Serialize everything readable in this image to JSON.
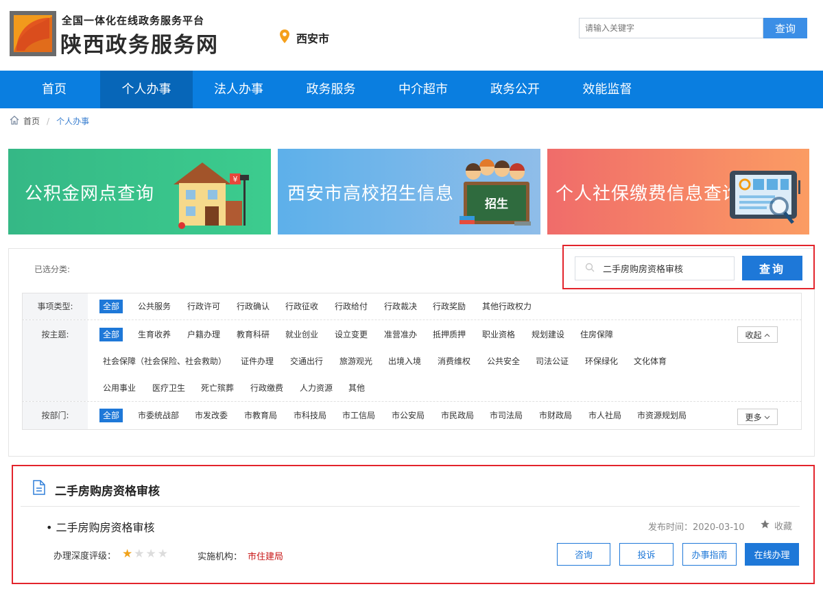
{
  "header": {
    "subtitle": "全国一体化在线政务服务平台",
    "title": "陕西政务服务网",
    "location": "西安市",
    "search_placeholder": "请输入关键字",
    "search_button": "查询"
  },
  "nav": {
    "items": [
      "首页",
      "个人办事",
      "法人办事",
      "政务服务",
      "中介超市",
      "政务公开",
      "效能监督"
    ],
    "active": "个人办事"
  },
  "breadcrumb": {
    "home": "首页",
    "current": "个人办事"
  },
  "banners": [
    {
      "text": "公积金网点查询",
      "color_from": "#35b886",
      "color_to": "#3ccc8e"
    },
    {
      "text": "西安市高校招生信息",
      "color_from": "#5db0ea",
      "color_to": "#8fbde9",
      "board_text": "招生"
    },
    {
      "text": "个人社保缴费信息查询",
      "color_from": "#f06c6a",
      "color_to": "#fb9c63"
    }
  ],
  "filter": {
    "selected_label": "已选分类:",
    "search_value": "二手房购房资格审核",
    "search_button": "查询",
    "type": {
      "label": "事项类型:",
      "items": [
        "全部",
        "公共服务",
        "行政许可",
        "行政确认",
        "行政征收",
        "行政给付",
        "行政裁决",
        "行政奖励",
        "其他行政权力"
      ]
    },
    "theme": {
      "label": "按主题:",
      "row1": [
        "全部",
        "生育收养",
        "户籍办理",
        "教育科研",
        "就业创业",
        "设立变更",
        "准营准办",
        "抵押质押",
        "职业资格",
        "规划建设",
        "住房保障"
      ],
      "row2": [
        "社会保障（社会保险、社会救助）",
        "证件办理",
        "交通出行",
        "旅游观光",
        "出境入境",
        "消费维权",
        "公共安全",
        "司法公证",
        "环保绿化",
        "文化体育"
      ],
      "row3": [
        "公用事业",
        "医疗卫生",
        "死亡殡葬",
        "行政缴费",
        "人力资源",
        "其他"
      ],
      "collapse_label": "收起"
    },
    "dept": {
      "label": "按部门:",
      "items": [
        "全部",
        "市委统战部",
        "市发改委",
        "市教育局",
        "市科技局",
        "市工信局",
        "市公安局",
        "市民政局",
        "市司法局",
        "市财政局",
        "市人社局",
        "市资源规划局"
      ],
      "more_label": "更多"
    }
  },
  "result": {
    "title": "二手房购房资格审核",
    "item_name": "二手房购房资格审核",
    "publish_label": "发布时间：",
    "publish_date": "2020-03-10",
    "favorite": "收藏",
    "level_label": "办理深度评级：",
    "rating": 1,
    "rating_max": 4,
    "org_label": "实施机构：",
    "org": "市住建局",
    "buttons": {
      "consult": "咨询",
      "complain": "投诉",
      "guide": "办事指南",
      "online": "在线办理"
    }
  },
  "colors": {
    "primary": "#0a7ee0",
    "accent": "#1e78d8",
    "highlight": "#e3232b",
    "star": "#f0a21a"
  }
}
